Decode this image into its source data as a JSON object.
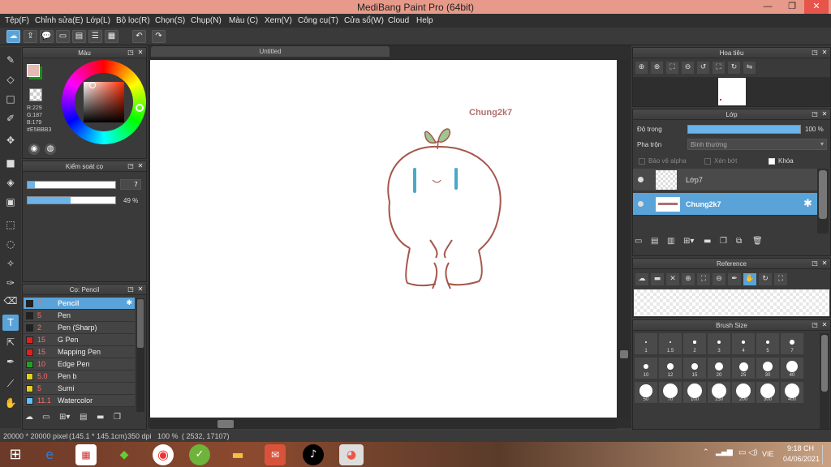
{
  "window": {
    "title": "MediBang Paint Pro (64bit)",
    "min_label": "—",
    "max_label": "❐",
    "close_label": "✕"
  },
  "menu": [
    "Tệp(F)",
    "Chỉnh sửa(E)",
    "Lớp(L)",
    "Bộ lọc(R)",
    "Chọn(S)",
    "Chụp(N)",
    "Màu (C)",
    "Xem(V)",
    "Công cụ(T)",
    "Cửa sổ(W)",
    "Cloud",
    "Help"
  ],
  "document": {
    "tab_title": "Untitled",
    "drawing_text": "Chung2k7"
  },
  "color_panel": {
    "title": "Màu",
    "r": "R:229",
    "g": "G:187",
    "b": "B:179",
    "hex": "#E5BBB3",
    "primary_color": "#e5bbb3",
    "secondary_color": "#1e8c1e"
  },
  "brush_control": {
    "title": "Kiểm soát cọ",
    "size_value": "7",
    "opacity_value": "49 %",
    "opacity_fraction": 0.49,
    "size_fraction": 0.08
  },
  "brush_panel": {
    "title": "Cọ: Pencil",
    "items": [
      {
        "size": "7",
        "name": "Pencil",
        "color": "#222222"
      },
      {
        "size": "5",
        "name": "Pen",
        "color": "#222222"
      },
      {
        "size": "2",
        "name": "Pen (Sharp)",
        "color": "#222222"
      },
      {
        "size": "15",
        "name": "G Pen",
        "color": "#e02020"
      },
      {
        "size": "15",
        "name": "Mapping Pen",
        "color": "#e02020"
      },
      {
        "size": "10",
        "name": "Edge Pen",
        "color": "#20a020"
      },
      {
        "size": "5.0",
        "name": " Pen b",
        "color": "#e0d020"
      },
      {
        "size": "5",
        "name": "Sumi",
        "color": "#e0d020"
      },
      {
        "size": "11.1",
        "name": "Watercolor",
        "color": "#60c0ff"
      }
    ]
  },
  "navigator": {
    "title": "Hoa tiêu"
  },
  "layer_panel": {
    "title": "Lớp",
    "opacity_label": "Độ trong",
    "opacity_value": "100 %",
    "blend_label": "Pha trộn",
    "blend_value": "Bình thường",
    "protect_alpha": "Bảo vệ alpha",
    "clipping": "Xén bớt",
    "lock": "Khóa",
    "layers": [
      {
        "name": "Lớp7"
      },
      {
        "name": "Chung2k7"
      }
    ]
  },
  "reference": {
    "title": "Reference"
  },
  "brush_size": {
    "title": "Brush Size",
    "sizes": [
      "1",
      "1.5",
      "2",
      "3",
      "4",
      "5",
      "7",
      "10",
      "12",
      "15",
      "20",
      "25",
      "30",
      "40",
      "50",
      "70",
      "100",
      "150",
      "200",
      "300",
      "400"
    ]
  },
  "status": {
    "size": "20000 * 20000 pixel",
    "physical": "(145.1 * 145.1cm)",
    "dpi": "350 dpi",
    "zoom": "100 %",
    "coords": "( 2532, 17107)"
  },
  "taskbar": {
    "time": "9:18 CH",
    "date": "04/06/2021",
    "lang": "VIE"
  }
}
